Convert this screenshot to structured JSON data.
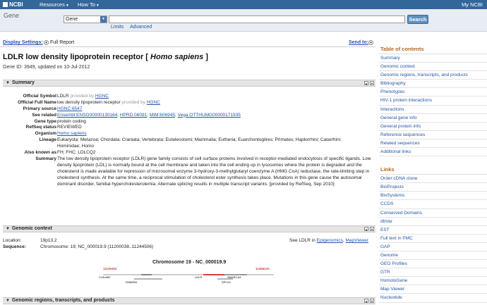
{
  "topbar": {
    "logo": "NCBI",
    "resources": "Resources",
    "howto": "How To",
    "myncbi": "My NCBI"
  },
  "search": {
    "db_label": "Gene",
    "db_selected": "Gene",
    "term": "",
    "button": "Search",
    "limits": "Limits",
    "advanced": "Advanced"
  },
  "display": {
    "settings": "Display Settings:",
    "format": "Full Report",
    "send_to": "Send to:"
  },
  "page": {
    "title_main": "LDLR low density lipoprotein receptor [",
    "title_species": "Homo sapiens",
    "title_end": "]",
    "gene_id": "Gene ID: 3949, updated on 10-Jul-2012"
  },
  "summary": {
    "header": "Summary",
    "official_symbol_label": "Official Symbol",
    "official_symbol": "LDLR",
    "provided_by": "provided by",
    "hgnc": "HGNC",
    "official_full_name_label": "Official Full Name",
    "official_full_name": "low density lipoprotein receptor",
    "primary_source_label": "Primary source",
    "primary_source": "HGNC:6547",
    "see_related_label": "See related",
    "see_related": [
      "Ensembl:ENSG00000130164",
      "HPRD:06091",
      "MIM:606945",
      "Vega:OTTHUMG00000171935"
    ],
    "gene_type_label": "Gene type",
    "gene_type": "protein coding",
    "refseq_status_label": "RefSeq status",
    "refseq_status": "REVIEWED",
    "organism_label": "Organism",
    "organism": "Homo sapiens",
    "lineage_label": "Lineage",
    "lineage_1": "Eukaryota; Metazoa; Chordata; Craniata; Vertebrata; Euteleostomi; Mammalia; Eutheria; Euarchontoglires; Primates; Haplorrhini; Catarrhini;",
    "lineage_2": "Hominidae; Homo",
    "aka_label": "Also known as",
    "aka": "FH; FHC; LDLCQ2",
    "summary_label": "Summary",
    "summary_text": "The low density lipoprotein receptor (LDLR) gene family consists of cell surface proteins involved in receptor-mediated endocytosis of specific ligands. Low density lipoprotein (LDL) is normally bound at the cell membrane and taken into the cell ending up in lysosomes where the protein is degraded and the cholesterol is made available for repression of microsomal enzyme 3-hydroxy-3-methylglutaryl coenzyme A (HMG CoA) reductase, the rate-limiting step in cholesterol synthesis. At the same time, a reciprocal stimulation of cholesterol ester synthesis takes place. Mutations in this gene cause the autosomal dominant disorder, familial hypercholesterolemia. Alternate splicing results in multiple transcript variants. [provided by RefSeq, Sep 2010]"
  },
  "genomic_context": {
    "header": "Genomic context",
    "location_label": "Location:",
    "location": "19p13.2",
    "sequence_label": "Sequence:",
    "sequence": "Chromosome: 19; NC_000019.9 (11200038..11244506)",
    "see_prefix": "See LDLR in",
    "epigenomics": "Epigenomics",
    "mapviewer": "MapViewer",
    "chrom_title": "Chromosome 19 - NC_000019.9",
    "left_coord": "11109484",
    "right_coord": "11368243",
    "genes": [
      "C19orf52",
      "DNM2B4",
      "LDLR",
      "SMARCA4",
      "SPC24"
    ]
  },
  "next_section": {
    "header": "Genomic regions, transcripts, and products"
  },
  "sidebar": {
    "toc_head": "Table of contents",
    "toc": [
      "Summary",
      "Genomic context",
      "Genomic regions, transcripts, and products",
      "Bibliography",
      "Phenotypes",
      "HIV-1 protein interactions",
      "Interactions",
      "General gene info",
      "General protein info",
      "Reference sequences",
      "Related sequences",
      "Additional links"
    ],
    "links_head": "Links",
    "links": [
      "Order cDNA clone",
      "BioProjects",
      "BioSystems",
      "CCDS",
      "Conserved Domains",
      "dbVar",
      "EST",
      "Full text in PMC",
      "GAP",
      "Genome",
      "GEO Profiles",
      "GTR",
      "HomoloGene",
      "Map Viewer",
      "Nucleotide"
    ]
  }
}
